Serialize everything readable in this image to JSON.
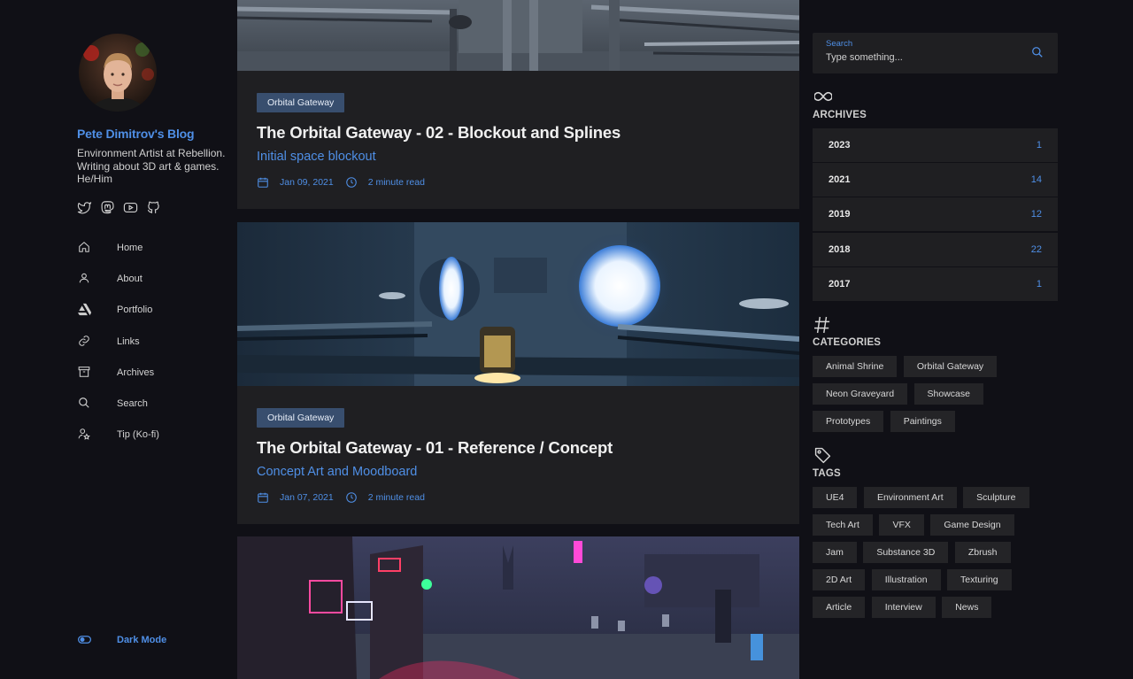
{
  "sidebar": {
    "blog_title": "Pete Dimitrov's Blog",
    "bio": "Environment Artist at Rebellion. Writing about 3D art & games. He/Him",
    "socials": [
      "twitter-icon",
      "mastodon-icon",
      "youtube-icon",
      "github-icon"
    ],
    "nav": [
      {
        "label": "Home",
        "icon": "home-icon"
      },
      {
        "label": "About",
        "icon": "user-icon"
      },
      {
        "label": "Portfolio",
        "icon": "artstation-icon"
      },
      {
        "label": "Links",
        "icon": "link-icon"
      },
      {
        "label": "Archives",
        "icon": "archive-icon"
      },
      {
        "label": "Search",
        "icon": "search-icon"
      },
      {
        "label": "Tip (Ko-fi)",
        "icon": "tip-icon"
      }
    ],
    "dark_mode_label": "Dark Mode"
  },
  "posts": [
    {
      "category": "Orbital Gateway",
      "title": "The Orbital Gateway - 02 - Blockout and Splines",
      "subtitle": "Initial space blockout",
      "date": "Jan 09, 2021",
      "read_time": "2 minute read"
    },
    {
      "category": "Orbital Gateway",
      "title": "The Orbital Gateway - 01 - Reference / Concept",
      "subtitle": "Concept Art and Moodboard",
      "date": "Jan 07, 2021",
      "read_time": "2 minute read"
    }
  ],
  "search": {
    "label": "Search",
    "placeholder": "Type something..."
  },
  "archives": {
    "title": "ARCHIVES",
    "items": [
      {
        "year": "2023",
        "count": "1"
      },
      {
        "year": "2021",
        "count": "14"
      },
      {
        "year": "2019",
        "count": "12"
      },
      {
        "year": "2018",
        "count": "22"
      },
      {
        "year": "2017",
        "count": "1"
      }
    ]
  },
  "categories": {
    "title": "CATEGORIES",
    "items": [
      "Animal Shrine",
      "Orbital Gateway",
      "Neon Graveyard",
      "Showcase",
      "Prototypes",
      "Paintings"
    ]
  },
  "tags": {
    "title": "TAGS",
    "items": [
      "UE4",
      "Environment Art",
      "Sculpture",
      "Tech Art",
      "VFX",
      "Game Design",
      "Jam",
      "Substance 3D",
      "Zbrush",
      "2D Art",
      "Illustration",
      "Texturing",
      "Article",
      "Interview",
      "News"
    ]
  },
  "colors": {
    "accent": "#4f8fe6",
    "card": "#1f1f22",
    "background": "#101016",
    "badge": "#384e6e"
  }
}
